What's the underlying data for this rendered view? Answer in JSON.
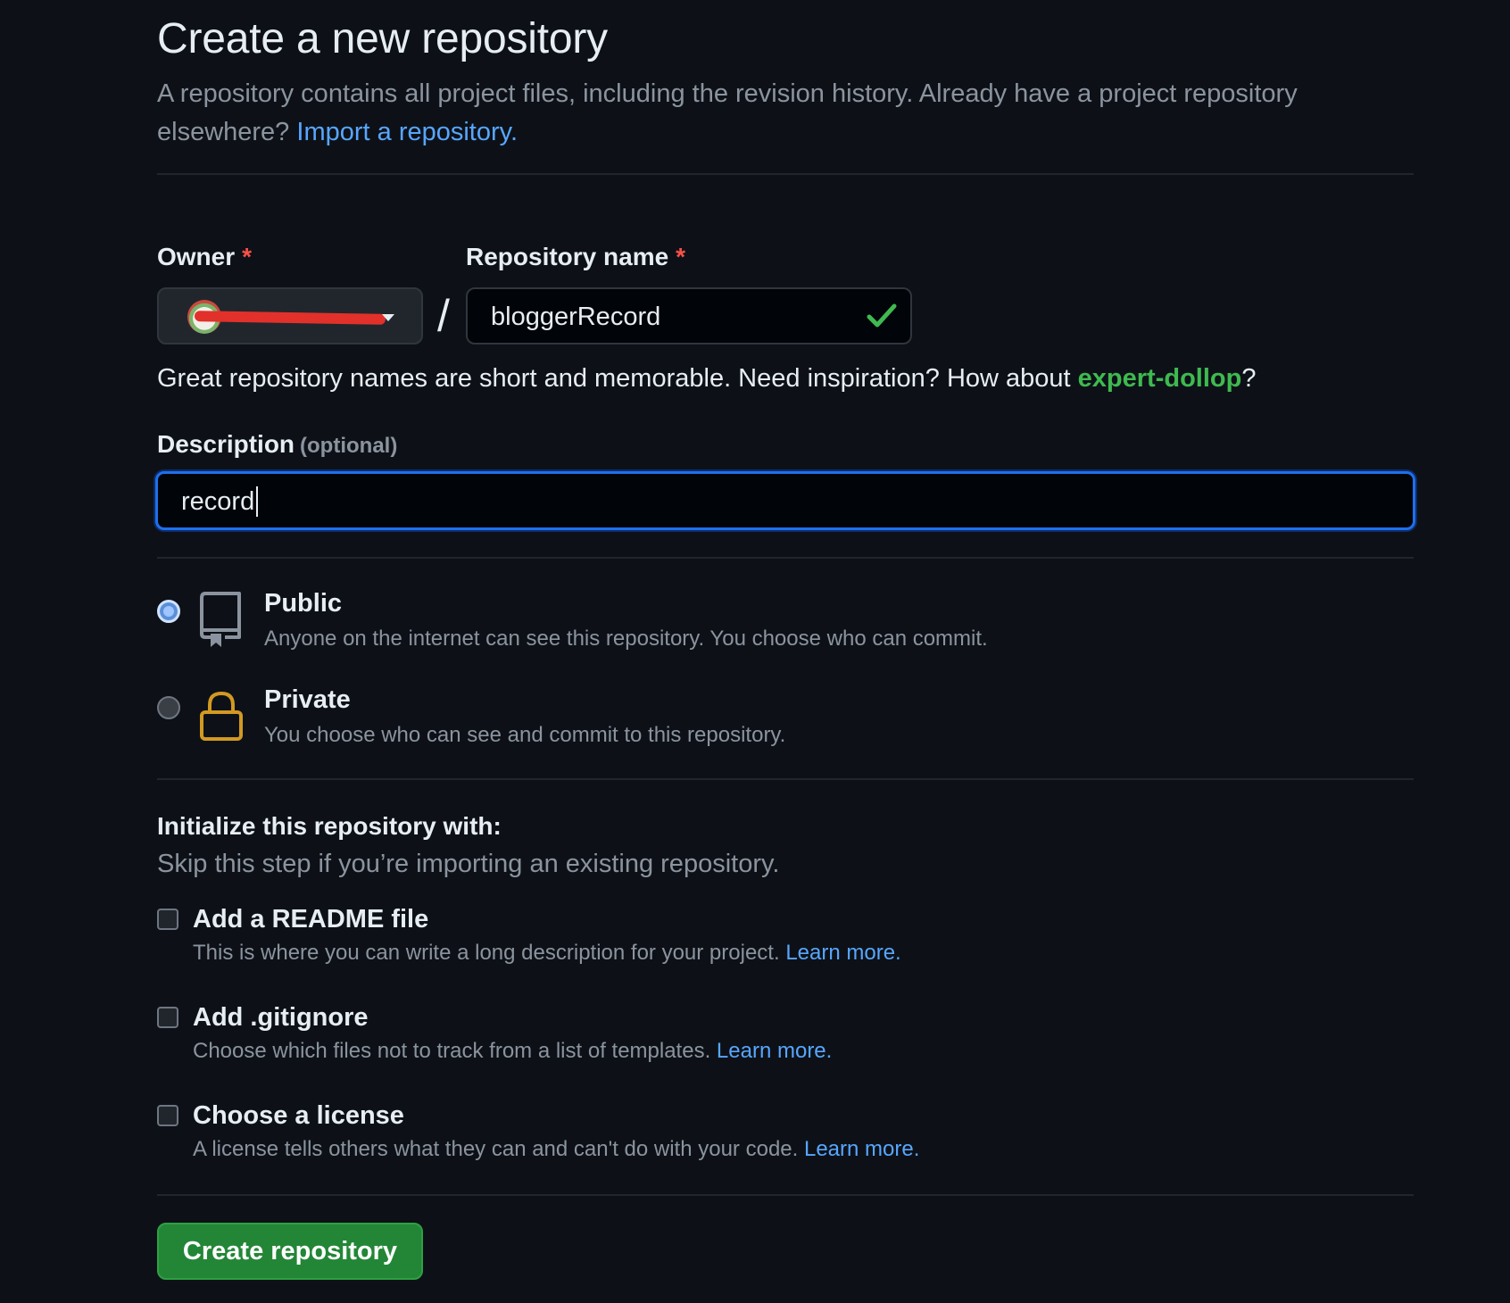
{
  "header": {
    "title": "Create a new repository",
    "subtitle_text": "A repository contains all project files, including the revision history. Already have a project repository elsewhere?",
    "import_link": "Import a repository."
  },
  "owner": {
    "label": "Owner",
    "required_mark": "*"
  },
  "repository_name": {
    "label": "Repository name",
    "required_mark": "*",
    "value": "bloggerRecord",
    "valid_icon": "check-icon"
  },
  "name_hint": {
    "text": "Great repository names are short and memorable. Need inspiration? How about",
    "suggestion": "expert-dollop",
    "suffix": "?"
  },
  "description": {
    "label": "Description",
    "optional": "(optional)",
    "value": "record"
  },
  "visibility": {
    "selected": "public",
    "options": [
      {
        "key": "public",
        "title": "Public",
        "description": "Anyone on the internet can see this repository. You choose who can commit.",
        "icon": "repo-icon"
      },
      {
        "key": "private",
        "title": "Private",
        "description": "You choose who can see and commit to this repository.",
        "icon": "lock-icon"
      }
    ]
  },
  "initialize": {
    "title": "Initialize this repository with:",
    "subtitle": "Skip this step if you’re importing an existing repository.",
    "items": [
      {
        "title": "Add a README file",
        "description": "This is where you can write a long description for your project.",
        "link": "Learn more.",
        "checked": false
      },
      {
        "title": "Add .gitignore",
        "description": "Choose which files not to track from a list of templates.",
        "link": "Learn more.",
        "checked": false
      },
      {
        "title": "Choose a license",
        "description": "A license tells others what they can and can't do with your code.",
        "link": "Learn more.",
        "checked": false
      }
    ]
  },
  "submit": {
    "label": "Create repository"
  },
  "colors": {
    "background": "#0d1117",
    "accent_link": "#58a6ff",
    "success": "#3fb950",
    "button": "#238636",
    "required": "#f85149",
    "private_icon": "#d29922"
  }
}
